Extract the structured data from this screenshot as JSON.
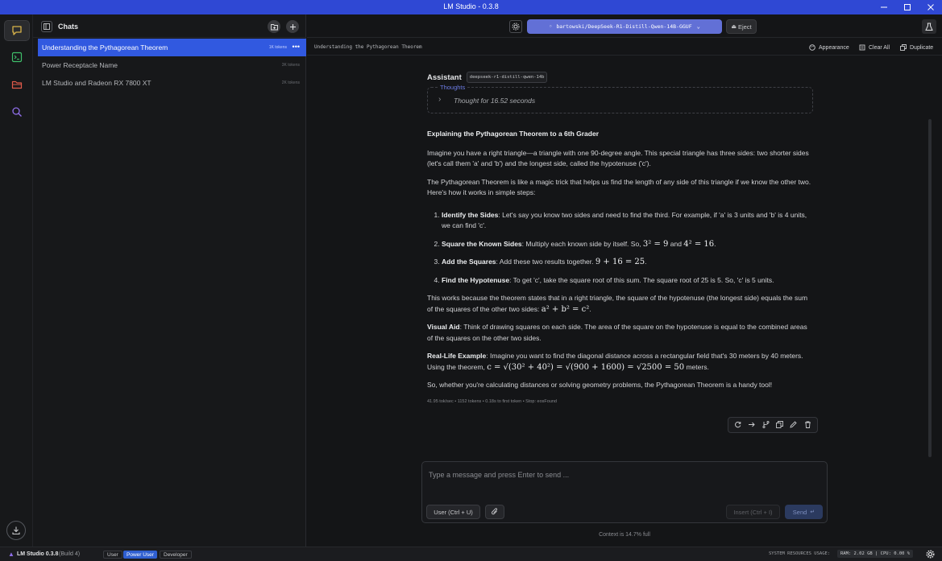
{
  "window": {
    "title": "LM Studio - 0.3.8"
  },
  "chats_panel": {
    "title": "Chats",
    "items": [
      {
        "title": "Understanding the Pythagorean Theorem",
        "tokens": "1K tokens",
        "active": true
      },
      {
        "title": "Power Receptacle Name",
        "tokens": "3K tokens",
        "active": false
      },
      {
        "title": "LM Studio and Radeon RX 7800 XT",
        "tokens": "2K tokens",
        "active": false
      }
    ]
  },
  "topbar": {
    "model": "bartowski/DeepSeek-R1-Distill-Qwen-14B-GGUF",
    "eject": "Eject"
  },
  "subbar": {
    "chat_title": "Understanding the Pythagorean Theorem",
    "appearance": "Appearance",
    "clear_all": "Clear All",
    "duplicate": "Duplicate"
  },
  "message": {
    "role": "Assistant",
    "model_tag": "deepseek-r1-distill-qwen-14b",
    "thoughts_label": "Thoughts",
    "thoughts_text": "Thought for 16.52 seconds",
    "heading": "Explaining the Pythagorean Theorem to a 6th Grader",
    "p1": "Imagine you have a right triangle—a triangle with one 90-degree angle. This special triangle has three sides: two shorter sides (let's call them 'a' and 'b') and the longest side, called the hypotenuse ('c').",
    "p2": "The Pythagorean Theorem is like a magic trick that helps us find the length of any side of this triangle if we know the other two. Here's how it works in simple steps:",
    "steps": [
      {
        "title": "Identify the Sides",
        "text": ": Let's say you know two sides and need to find the third. For example, if 'a' is 3 units and 'b' is 4 units, we can find 'c'."
      },
      {
        "title": "Square the Known Sides",
        "text": ": Multiply each known side by itself. So, ",
        "math1": "3² = 9",
        "mid": " and ",
        "math2": "4² = 16",
        "end": "."
      },
      {
        "title": "Add the Squares",
        "text": ": Add these two results together. ",
        "math1": "9 + 16 = 25",
        "end": "."
      },
      {
        "title": "Find the Hypotenuse",
        "text": ": To get 'c', take the square root of this sum. The square root of 25 is 5. So, 'c' is 5 units."
      }
    ],
    "p3": "This works because the theorem states that in a right triangle, the square of the hypotenuse (the longest side) equals the sum of the squares of the other two sides: ",
    "p3_math": "a² + b² = c²",
    "p3_end": ".",
    "visual_title": "Visual Aid",
    "visual_text": ": Think of drawing squares on each side. The area of the square on the hypotenuse is equal to the combined areas of the squares on the other two sides.",
    "real_title": "Real-Life Example",
    "real_text": ": Imagine you want to find the diagonal distance across a rectangular field that's 30 meters by 40 meters. Using the theorem, ",
    "real_math": "c = √(30² + 40²) = √(900 + 1600) = √2500 = 50",
    "real_end": " meters.",
    "p_final": "So, whether you're calculating distances or solving geometry problems, the Pythagorean Theorem is a handy tool!",
    "stats": "41.95 tok/sec • 1152 tokens • 0.18s to first token • Stop: eosFound"
  },
  "composer": {
    "placeholder": "Type a message and press Enter to send ...",
    "user_button": "User (Ctrl + U)",
    "insert_button": "Insert (Ctrl + I)",
    "send_button": "Send",
    "context": "Context is 14.7% full"
  },
  "status_bar": {
    "app": "LM Studio 0.3.8",
    "build": "(Build 4)",
    "modes": [
      "User",
      "Power User",
      "Developer"
    ],
    "active_mode": "Power User",
    "resources_label": "SYSTEM RESOURCES USAGE:",
    "resources": "RAM: 2.02 GB | CPU: 0.00 %"
  },
  "colors": {
    "accent": "#3159e0",
    "titlebar": "#2f48d4",
    "model_pill": "#6270d6",
    "rail_chat": "#d8b24a",
    "rail_terminal": "#3fbf6a",
    "rail_folder": "#e05a4a",
    "rail_search": "#8f6ee8"
  }
}
